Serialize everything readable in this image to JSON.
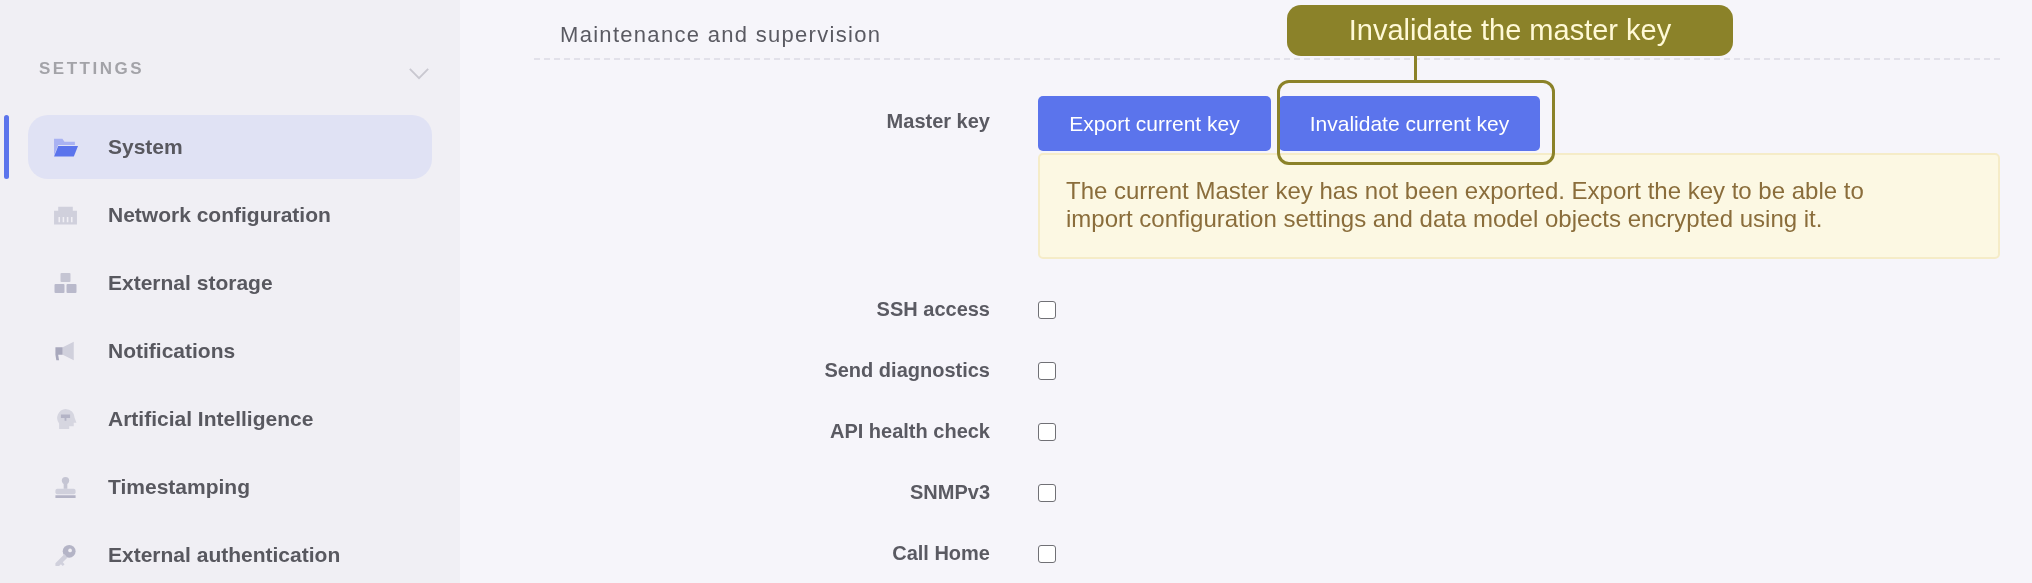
{
  "sidebar": {
    "section": "SETTINGS",
    "expanded": true,
    "items": [
      {
        "label": "System",
        "selected": true
      },
      {
        "label": "Network configuration",
        "selected": false
      },
      {
        "label": "External storage",
        "selected": false
      },
      {
        "label": "Notifications",
        "selected": false
      },
      {
        "label": "Artificial Intelligence",
        "selected": false
      },
      {
        "label": "Timestamping",
        "selected": false
      },
      {
        "label": "External authentication",
        "selected": false
      }
    ]
  },
  "section": {
    "title": "Maintenance and supervision",
    "master_key": {
      "label": "Master key",
      "buttons": [
        "Export current key",
        "Invalidate current key"
      ],
      "warning": "The current Master key has not been exported. Export the key to be able to import configuration settings and data model objects encrypted using it."
    },
    "callout": "Invalidate the master key",
    "options": [
      {
        "label": "SSH access",
        "checked": false
      },
      {
        "label": "Send diagnostics",
        "checked": false
      },
      {
        "label": "API health check",
        "checked": false
      },
      {
        "label": "SNMPv3",
        "checked": false
      },
      {
        "label": "Call Home",
        "checked": false
      }
    ]
  }
}
